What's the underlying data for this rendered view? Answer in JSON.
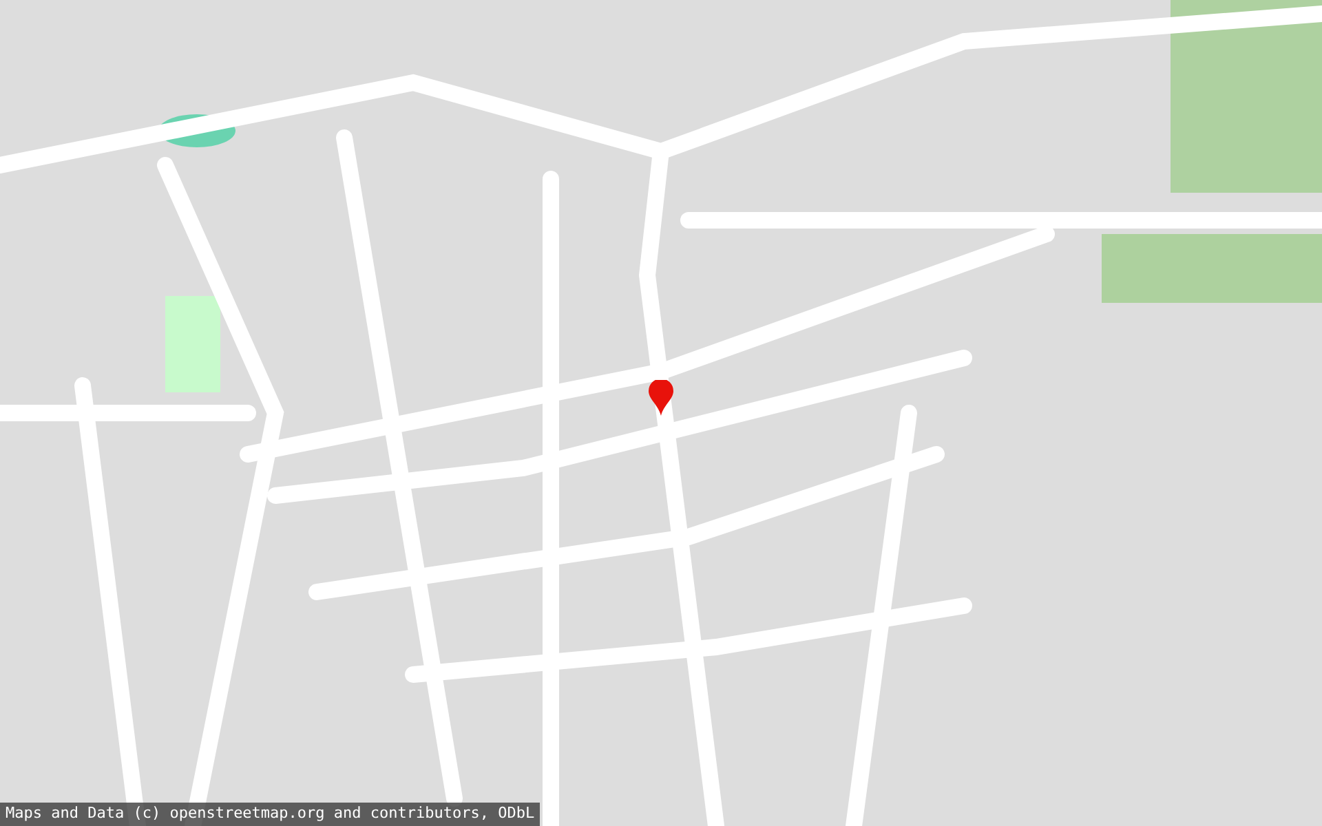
{
  "map": {
    "attribution": "Maps and Data (c) openstreetmap.org and contributors, ODbL"
  }
}
